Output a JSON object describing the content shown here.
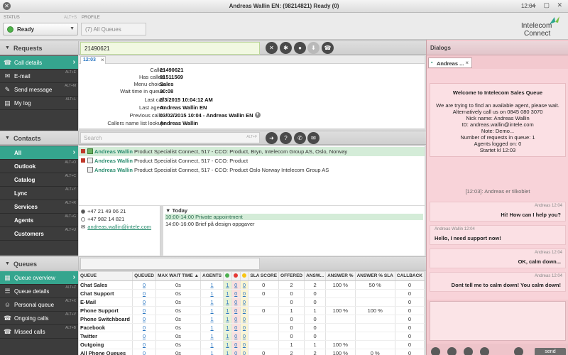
{
  "window": {
    "close_glyph": "✕",
    "title": "Andreas Wallin EN: (98214821) Ready (0)",
    "clock": "12:04",
    "controls": "— ▢ ✕"
  },
  "header": {
    "status_label": "STATUS",
    "status_shortcut": "ALT+S",
    "status_value": "Ready",
    "profile_label": "PROFILE",
    "profile_value": "(7) All Queues",
    "logo_line1": "Intelecom",
    "logo_line2": "Connect",
    "colors": {
      "ready": "#4fb34a",
      "accent": "#35a58e",
      "dialog_bg": "#f3c9cf"
    }
  },
  "requests": {
    "section_title": "Requests",
    "phone_number": "21490621",
    "tab_time": "12:03",
    "tab_close": "×",
    "nav": [
      {
        "label": "Call details",
        "icon": "phone-icon",
        "glyph": "☎",
        "shortcut": ""
      },
      {
        "label": "E-mail",
        "icon": "mail-icon",
        "glyph": "✉",
        "shortcut": "ALT+E"
      },
      {
        "label": "Send message",
        "icon": "chat-icon",
        "glyph": "✎",
        "shortcut": "ALT+M"
      },
      {
        "label": "My log",
        "icon": "log-icon",
        "glyph": "▤",
        "shortcut": "ALT+L"
      }
    ],
    "nav_chevron": "›",
    "buttons": [
      {
        "name": "mute-icon",
        "glyph": "✕"
      },
      {
        "name": "keypad-icon",
        "glyph": "✱"
      },
      {
        "name": "record-icon",
        "glyph": "●"
      },
      {
        "name": "transfer-icon",
        "glyph": "⬇"
      },
      {
        "name": "hangup-icon",
        "glyph": "☎"
      }
    ],
    "details": [
      {
        "k": "Caller",
        "v": "21490621"
      },
      {
        "k": "Has called",
        "v": "81511569"
      },
      {
        "k": "Menu choice",
        "v": "Sales"
      },
      {
        "k": "Wait time in queue",
        "v": "00:08"
      },
      {
        "k": "Last call",
        "v": "2/3/2015 10:04:12 AM"
      },
      {
        "k": "Last agent",
        "v": "Andreas Wallin EN"
      },
      {
        "k": "Previous calls:",
        "v": "03/02/2015 10:04 - Andreas Wallin EN"
      },
      {
        "k": "Callers name list lookup",
        "v": "Andreas Wallin"
      }
    ],
    "plus_glyph": "+"
  },
  "contacts": {
    "section_title": "Contacts",
    "search_placeholder": "Search",
    "search_shortcut": "ALT+F",
    "nav": [
      {
        "label": "All",
        "shortcut": ""
      },
      {
        "label": "Outlook",
        "shortcut": "ALT+O"
      },
      {
        "label": "Catalog",
        "shortcut": "ALT+C"
      },
      {
        "label": "Lync",
        "shortcut": "ALT+Y"
      },
      {
        "label": "Services",
        "shortcut": "ALT+R"
      },
      {
        "label": "Agents",
        "shortcut": "ALT+G"
      },
      {
        "label": "Customers",
        "shortcut": "ALT+U"
      }
    ],
    "nav_chevron": "›",
    "buttons": [
      {
        "name": "forward-icon",
        "glyph": "➜"
      },
      {
        "name": "help-icon",
        "glyph": "?"
      },
      {
        "name": "call-icon",
        "glyph": "✆"
      },
      {
        "name": "email-icon",
        "glyph": "✉"
      }
    ],
    "results": [
      {
        "name": "Andreas Wallin",
        "rest": " Product Specialist Connect,  517 - CCO: Product,  Bryn,  Intelecom Group AS,  Oslo,  Norway"
      },
      {
        "name": "Andreas Wallin",
        "rest": " Product Specialist Connect,  517 - CCO: Product"
      },
      {
        "name": "Andreas Wallin",
        "rest": " Product Specialist Connect,  517 - CCO: Product Oslo Norway Intelecom Group AS"
      }
    ],
    "info": {
      "phone1": "+47 21 49 06 21",
      "phone2": "+47 982 14 821",
      "email": "andreas.wallin@intele.com"
    },
    "calendar": {
      "today_label": "▼ Today",
      "items": [
        "10:00-14:00  Private appointment",
        "14:00-16:00  Brief på design oppgaver"
      ]
    }
  },
  "queues": {
    "section_title": "Queues",
    "nav": [
      {
        "label": "Queue overview",
        "icon": "queue-overview-icon",
        "glyph": "▦",
        "shortcut": ""
      },
      {
        "label": "Queue details",
        "icon": "queue-details-icon",
        "glyph": "☰",
        "shortcut": "ALT+Z"
      },
      {
        "label": "Personal queue",
        "icon": "person-icon",
        "glyph": "☺",
        "shortcut": "ALT+X"
      },
      {
        "label": "Ongoing calls",
        "icon": "ongoing-calls-icon",
        "glyph": "☎",
        "shortcut": "ALT+V"
      },
      {
        "label": "Missed calls",
        "icon": "missed-calls-icon",
        "glyph": "☎",
        "shortcut": "ALT+B"
      }
    ],
    "nav_chevron": "›",
    "columns": [
      "QUEUE",
      "QUEUED",
      "MAX WAIT TIME ▲",
      "AGENTS",
      "",
      "",
      "",
      "SLA SCORE",
      "OFFERED",
      "ANSW...",
      "ANSWER %",
      "ANSWER % SLA",
      "CALLBACK"
    ],
    "dot_colors": [
      "#4caf50",
      "#e53935",
      "#f9c513"
    ],
    "rows": [
      [
        "Chat Sales",
        "0",
        "0s",
        "1",
        "1",
        "0",
        "0",
        "0",
        "2",
        "2",
        "100 %",
        "50 %",
        "0"
      ],
      [
        "Chat Support",
        "0",
        "0s",
        "1",
        "1",
        "0",
        "0",
        "0",
        "0",
        "0",
        "",
        "",
        "0"
      ],
      [
        "E-Mail",
        "0",
        "0s",
        "1",
        "1",
        "0",
        "0",
        "",
        "0",
        "0",
        "",
        "",
        "0"
      ],
      [
        "Phone Support",
        "0",
        "0s",
        "1",
        "1",
        "0",
        "0",
        "0",
        "1",
        "1",
        "100 %",
        "100 %",
        "0"
      ],
      [
        "Phone Switchboard",
        "0",
        "0s",
        "1",
        "1",
        "0",
        "0",
        "",
        "0",
        "0",
        "",
        "",
        "0"
      ],
      [
        "Facebook",
        "0",
        "0s",
        "1",
        "1",
        "0",
        "0",
        "",
        "0",
        "0",
        "",
        "",
        "0"
      ],
      [
        "Twitter",
        "0",
        "0s",
        "1",
        "1",
        "0",
        "0",
        "",
        "0",
        "0",
        "",
        "",
        "0"
      ],
      [
        "Outgoing",
        "0",
        "0s",
        "1",
        "1",
        "0",
        "0",
        "",
        "1",
        "1",
        "100 %",
        "",
        "0"
      ],
      [
        "All Phone Queues",
        "0",
        "0s",
        "1",
        "1",
        "0",
        "0",
        "0",
        "2",
        "2",
        "100 %",
        "0 %",
        "0"
      ]
    ]
  },
  "dialogs": {
    "section_title": "Dialogs",
    "tab_label": "Andreas ...",
    "tab_icon_glyph": "▪",
    "tab_close": "×",
    "welcome_lines": [
      "Welcome to Intelecom Sales Queue",
      "",
      "We are trying to find an available agent, please wait.",
      "Alternatively call us on 0845 080 3070",
      "Nick name: Andreas Wallin",
      "ID: andreas.wallin@intele.com",
      "Note: Demo...",
      "Number of requests in queue: 1",
      "Agents logged on: 0",
      "Startet kl 12:03"
    ],
    "system_message": "[12:03]: Andreas er tilkoblet",
    "messages": [
      {
        "who": "Andreas 12:04",
        "text": "Hi! How can I help you?",
        "side": "right"
      },
      {
        "who": "Andreas Wallin 12:04",
        "text": "Hello, I need support now!",
        "side": "left"
      },
      {
        "who": "Andreas 12:04",
        "text": "OK, calm down...",
        "side": "right"
      },
      {
        "who": "Andreas 12:04",
        "text": "Dont tell me to calm down! You calm down!",
        "side": "right"
      }
    ],
    "send_label": "send"
  }
}
